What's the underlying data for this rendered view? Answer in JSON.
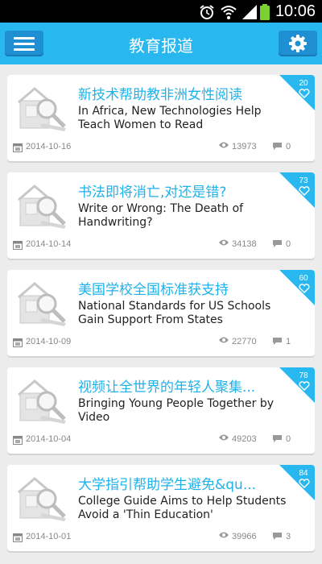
{
  "status_bar": {
    "time": "10:06"
  },
  "header": {
    "title": "教育报道",
    "menu_icon": "menu-icon",
    "settings_icon": "gear-icon"
  },
  "articles": [
    {
      "title_cn": "新技术帮助教非洲女性阅读",
      "title_en": "In Africa, New Technologies Help Teach Women to Read",
      "likes": "20",
      "date": "2014-10-16",
      "views": "13973",
      "comments": "0"
    },
    {
      "title_cn": "书法即将消亡,对还是错?",
      "title_en": "Write or Wrong: The Death of Handwriting?",
      "likes": "73",
      "date": "2014-10-14",
      "views": "34138",
      "comments": "0"
    },
    {
      "title_cn": "美国学校全国标准获支持",
      "title_en": "National Standards for US Schools Gain Support From States",
      "likes": "60",
      "date": "2014-10-09",
      "views": "22770",
      "comments": "1"
    },
    {
      "title_cn": "视频让全世界的年轻人聚集...",
      "title_en": "Bringing Young People Together by Video",
      "likes": "78",
      "date": "2014-10-04",
      "views": "49203",
      "comments": "0"
    },
    {
      "title_cn": "大学指引帮助学生避免&qu...",
      "title_en": "College Guide Aims to Help Students Avoid a 'Thin Education'",
      "likes": "84",
      "date": "2014-10-01",
      "views": "39966",
      "comments": "3"
    }
  ],
  "colors": {
    "accent": "#29b7ef",
    "button": "#1f8fd3",
    "title_cn": "#1fb2ea"
  }
}
